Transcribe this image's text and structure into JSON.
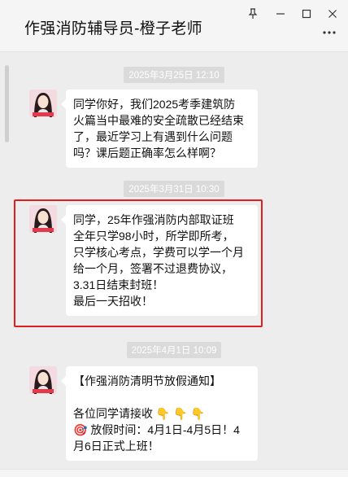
{
  "window": {
    "title": "作强消防辅导员-橙子老师",
    "pin_icon": "pin-icon",
    "minimize_icon": "minimize-icon",
    "maximize_icon": "maximize-icon",
    "close_icon": "close-icon",
    "more_icon": "more-options-icon"
  },
  "messages": [
    {
      "timestamp": "2025年3月25日 12:10",
      "lines": [
        "同学你好，我们2025考季建筑防",
        "火篇当中最难的安全疏散已经结束",
        "了，最近学习上有遇到什么问题",
        "吗？课后题正确率怎么样啊？"
      ]
    },
    {
      "timestamp": "2025年3月31日 10:30",
      "lines": [
        "同学，25年作强消防内部取证班",
        "全年只学98小时，所学即所考，",
        "只学核心考点，学费可以学一个月",
        "给一个月，签署不过退费协议，",
        "3.31日结束封班！",
        "最后一天招收！"
      ]
    },
    {
      "timestamp": "2025年4月1日 10:09",
      "lines": [
        "【作强消防清明节放假通知】",
        "",
        "各位同学请接收 👇 👇 👇",
        "🎯 放假时间：4月1日-4月5日！4",
        "月6日正式上班！"
      ]
    }
  ],
  "colors": {
    "background": "#ededed",
    "bubble": "#ffffff",
    "highlight": "#e02020",
    "timestamp_bg": "#dadada"
  }
}
